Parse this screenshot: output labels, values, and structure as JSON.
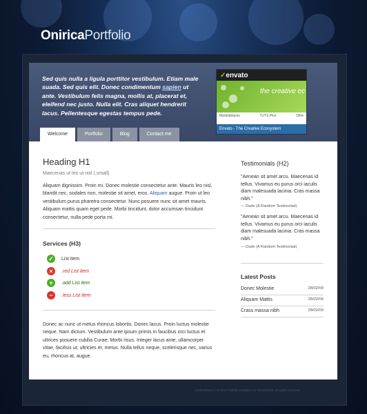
{
  "site": {
    "title_bold": "Onirica",
    "title_light": "Portfolio"
  },
  "intro": {
    "text_before": "Sed quis nulla a ligula porttitor vestibulum. Etiam male suada. Sed quis elit. Donec condimentum ",
    "link": "sapien",
    "text_after": " ut ante. Vestibulum felis magna, mollis at, placerat et, eleifend nec justo. Nulla elit. Cras aliquet hendrerit lacus. Pellentesque egestas tempus pede."
  },
  "screenshot": {
    "logo": "envato",
    "tagline": "the creative ec",
    "col1": "Marketplaces",
    "col2": "TUTS Plus",
    "col3": "Othe",
    "caption": "Envato - The Creative Ecosystem"
  },
  "tabs": [
    {
      "label": "Welcome",
      "active": true
    },
    {
      "label": "Portfolio",
      "active": false
    },
    {
      "label": "Blog",
      "active": false
    },
    {
      "label": "Contact me",
      "active": false
    }
  ],
  "main": {
    "heading": "Heading H1",
    "subheading": "Maecenas ut leo ut nisl (.small)",
    "para1_before": "Aliquam dignissim. Proin mi. Donec molestie consectetur ante. Mauris leo nisl, blandit nec, sodales non, molestie sit amet, eros. ",
    "para1_link": "Aliquam",
    "para1_after": " augue. Proin ut leo vestibulum purus pharetra consectetur. Nunc posuere nunc sit amet mauris. Aliquam mattis quam eget pede. Morbi tincidunt, dolor accumsan tincidunt consectetur, nulla pede porta mi.",
    "services_heading": "Services (H3)",
    "services": [
      {
        "label": "List item",
        "icon": "check-icon",
        "color": "#4caf28"
      },
      {
        "label": ".red List item",
        "icon": "cross-icon",
        "color": "#d9362b"
      },
      {
        "label": ".add List item",
        "icon": "plus-icon",
        "color": "#4caf28"
      },
      {
        "label": ".less List item",
        "icon": "minus-icon",
        "color": "#d9362b"
      }
    ],
    "para2_before": "Donec ac nunc ut metus rhoncus lobortis. Donec lacus. Proin luctus molestie neque. Nam dictum. Vestibulum ante ipsum primis in faucibus orci luctus et ultrices posuere cubilia Curae; Morbi risus. Integer lacus ante, ullamcorper ",
    "para2_italic": "vitae, facilisis ut",
    "para2_after": ", ultricies et, metus. Nulla tellus neque, scelerisque nec, varius eu, rhoncus at, augue."
  },
  "sidebar": {
    "testimonials_heading": "Testimonials (H2)",
    "testimonials": [
      {
        "quote": "\"Aenean sit amet arcu. Maecenas id tellus. Vivamus eu purus orci iaculis diam malesuada lacinia. Cras massa nibh.\"",
        "author": "— Dude (A Random Testimonial)"
      },
      {
        "quote": "\"Aenean sit amet arcu. Maecenas id tellus. Vivamus eu purus orci iaculis diam malesuada lacinia. Cras massa nibh.\"",
        "author": "— Dude (A Random Testimonial)"
      }
    ],
    "latest_heading": "Latest Posts",
    "posts": [
      {
        "title": "Donec Molestie",
        "date": "28/02/09"
      },
      {
        "title": "Aliquam Mattis",
        "date": "28/02/09"
      },
      {
        "title": "Crass massa nibh",
        "date": "28/02/09"
      }
    ]
  },
  "footer": {
    "text": "Kunkushima © Onirica Portfolio template via themeforest. All rights reserved."
  }
}
